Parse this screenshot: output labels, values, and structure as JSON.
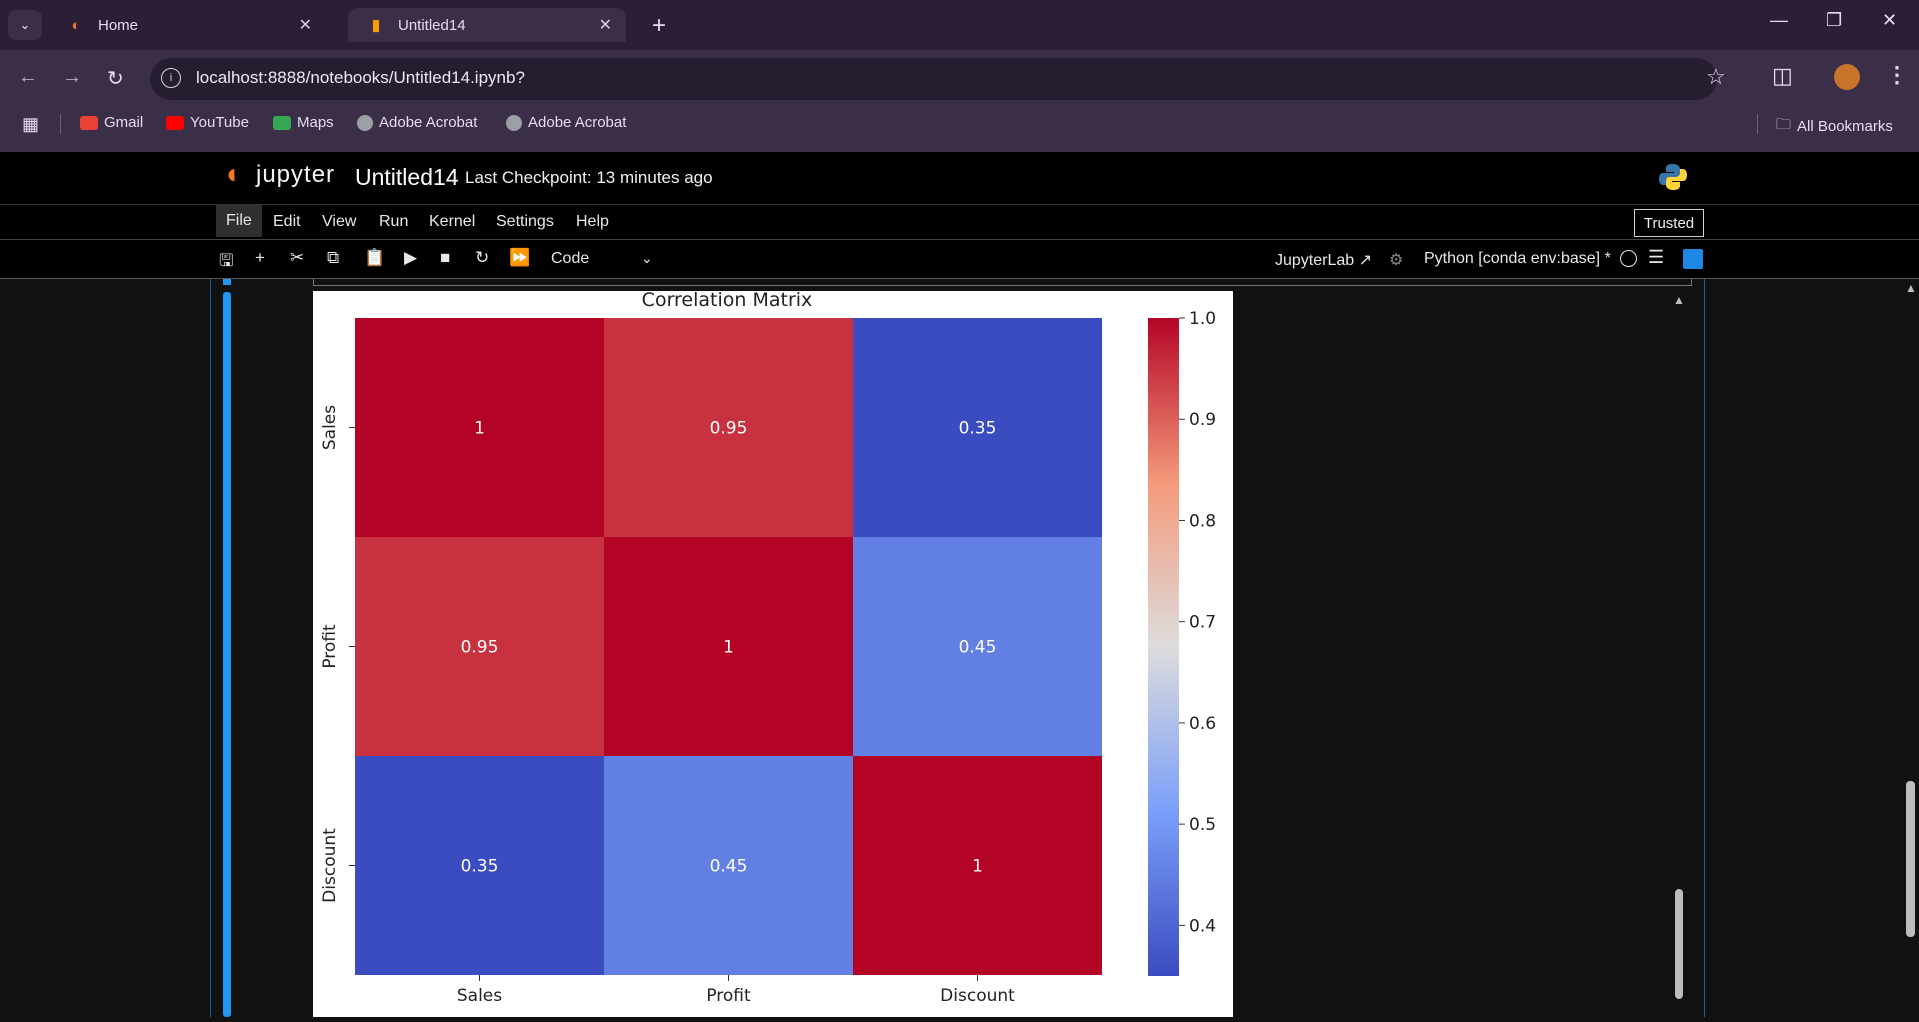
{
  "browser": {
    "tab_dropdown_icon": "chevron-down-icon",
    "tabs": [
      {
        "label": "Home",
        "icon": "jupyter-icon"
      },
      {
        "label": "Untitled14",
        "icon": "notebook-icon"
      }
    ],
    "url": "localhost:8888/notebooks/Untitled14.ipynb?",
    "bookmarks": [
      {
        "label": "Gmail",
        "color": "#ea4335"
      },
      {
        "label": "YouTube",
        "color": "#ff0000"
      },
      {
        "label": "Maps",
        "color": "#34a853"
      },
      {
        "label": "Adobe Acrobat",
        "color": "#9aa0a6"
      },
      {
        "label": "Adobe Acrobat",
        "color": "#9aa0a6"
      }
    ],
    "all_bookmarks": "All Bookmarks"
  },
  "jupyter": {
    "logo_text": "jupyter",
    "notebook_name": "Untitled14",
    "checkpoint": "Last Checkpoint: 13 minutes ago",
    "menu": [
      "File",
      "Edit",
      "View",
      "Run",
      "Kernel",
      "Settings",
      "Help"
    ],
    "trusted": "Trusted",
    "cell_type": "Code",
    "jupyterlab_link": "JupyterLab",
    "kernel": "Python [conda env:base] *"
  },
  "chart_data": {
    "type": "heatmap",
    "title": "Correlation Matrix",
    "x_labels": [
      "Sales",
      "Profit",
      "Discount"
    ],
    "y_labels": [
      "Sales",
      "Profit",
      "Discount"
    ],
    "values": [
      [
        1,
        0.95,
        0.35
      ],
      [
        0.95,
        1,
        0.45
      ],
      [
        0.35,
        0.45,
        1
      ]
    ],
    "annotations": [
      [
        "1",
        "0.95",
        "0.35"
      ],
      [
        "0.95",
        "1",
        "0.45"
      ],
      [
        "0.35",
        "0.45",
        "1"
      ]
    ],
    "colormap": "coolwarm",
    "colorbar": {
      "min": 0.35,
      "max": 1.0,
      "ticks": [
        "1.0",
        "0.9",
        "0.8",
        "0.7",
        "0.6",
        "0.5",
        "0.4"
      ]
    }
  }
}
